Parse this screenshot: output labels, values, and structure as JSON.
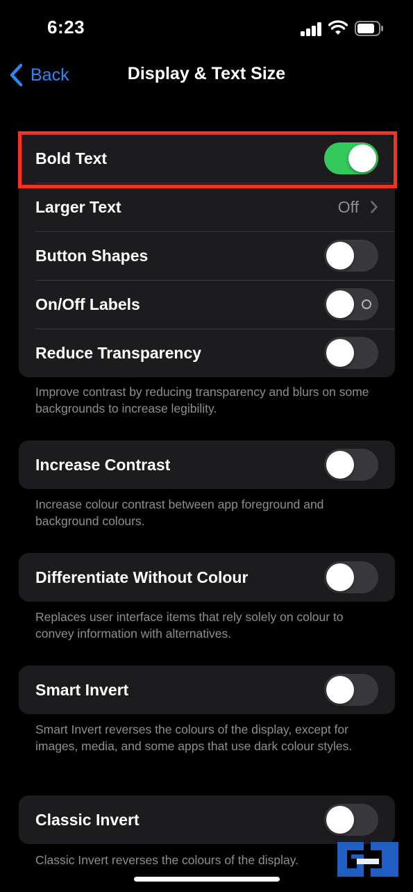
{
  "status_bar": {
    "time": "6:23",
    "icons": [
      "signal-icon",
      "wifi-icon",
      "battery-icon"
    ]
  },
  "nav": {
    "back_label": "Back",
    "title": "Display & Text Size"
  },
  "colors": {
    "background": "#000000",
    "cell": "#1c1c1e",
    "accent_blue": "#2e86f6",
    "toggle_on": "#34c759",
    "toggle_off": "#39393d",
    "footnote": "#8e8e93",
    "highlight": "#ff2e1f"
  },
  "groups": [
    {
      "rows": [
        {
          "label": "Bold Text",
          "control": "toggle",
          "on": true
        },
        {
          "label": "Larger Text",
          "control": "disclosure",
          "value": "Off"
        },
        {
          "label": "Button Shapes",
          "control": "toggle",
          "on": false
        },
        {
          "label": "On/Off Labels",
          "control": "toggle",
          "on": false
        },
        {
          "label": "Reduce Transparency",
          "control": "toggle",
          "on": false
        }
      ],
      "footnote": "Improve contrast by reducing transparency and blurs on some backgrounds to increase legibility."
    },
    {
      "rows": [
        {
          "label": "Increase Contrast",
          "control": "toggle",
          "on": false
        }
      ],
      "footnote": "Increase colour contrast between app foreground and background colours."
    },
    {
      "rows": [
        {
          "label": "Differentiate Without Colour",
          "control": "toggle",
          "on": false
        }
      ],
      "footnote": "Replaces user interface items that rely solely on colour to convey information with alternatives."
    },
    {
      "rows": [
        {
          "label": "Smart Invert",
          "control": "toggle",
          "on": false
        }
      ],
      "footnote": "Smart Invert reverses the colours of the display, except for images, media, and some apps that use dark colour styles."
    },
    {
      "rows": [
        {
          "label": "Classic Invert",
          "control": "toggle",
          "on": false
        }
      ],
      "footnote": "Classic Invert reverses the colours of the display."
    }
  ]
}
